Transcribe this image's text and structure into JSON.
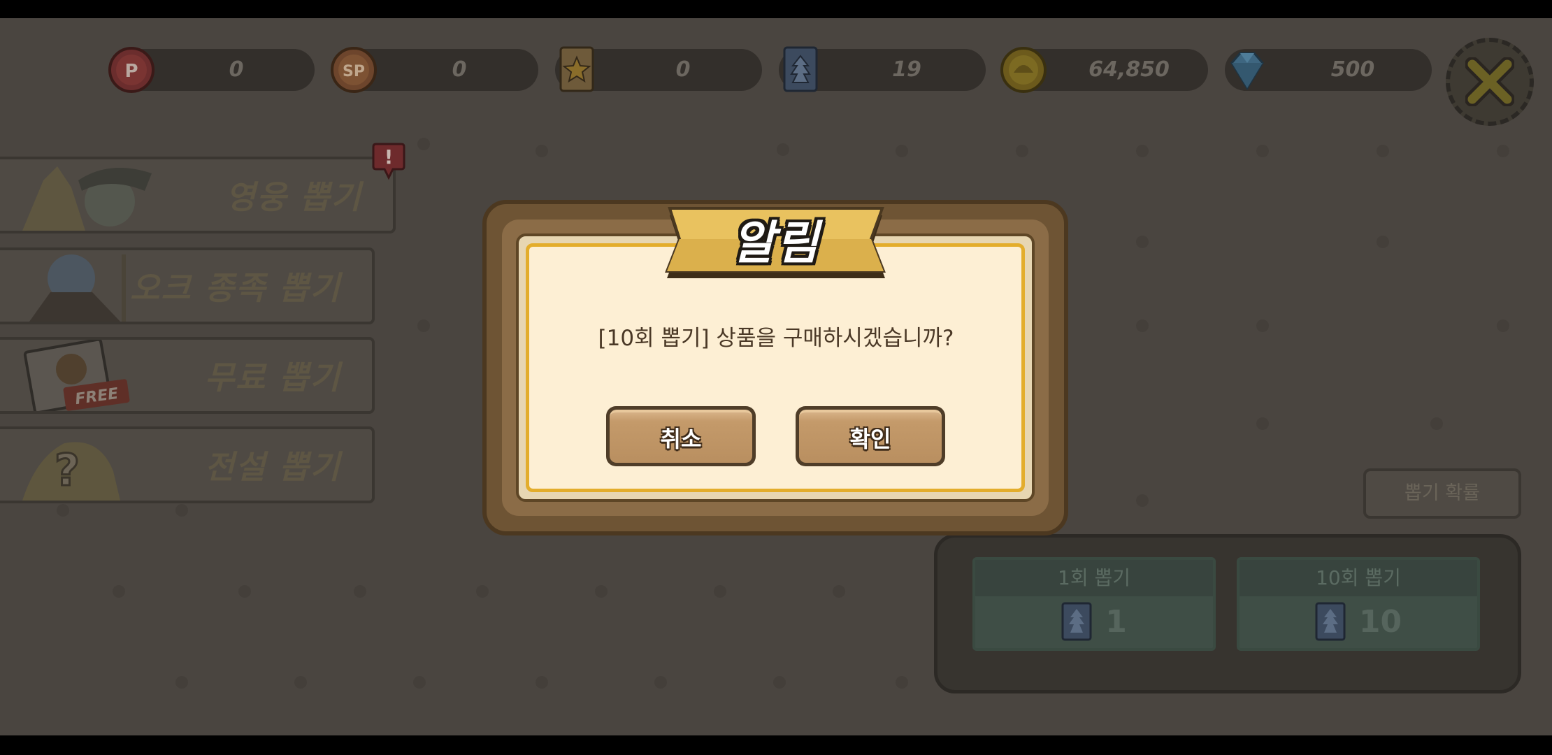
{
  "currencies": [
    {
      "name": "p-point",
      "icon": "p-coin-icon",
      "value": "0"
    },
    {
      "name": "sp-point",
      "icon": "sp-coin-icon",
      "value": "0"
    },
    {
      "name": "star-ticket",
      "icon": "star-ticket-icon",
      "value": "0"
    },
    {
      "name": "draw-ticket",
      "icon": "draw-ticket-icon",
      "value": "19"
    },
    {
      "name": "gold",
      "icon": "gold-coin-icon",
      "value": "64,850"
    },
    {
      "name": "diamond",
      "icon": "diamond-icon",
      "value": "500"
    }
  ],
  "menu": {
    "items": [
      {
        "label": "영웅 뽑기"
      },
      {
        "label": "오크 종족 뽑기"
      },
      {
        "label": "무료 뽑기",
        "tag": "FREE"
      },
      {
        "label": "전설 뽑기"
      }
    ],
    "alert_mark": "!"
  },
  "odds_button": "뽑기 확률",
  "draw_options": [
    {
      "title": "1회 뽑기",
      "cost": "1"
    },
    {
      "title": "10회 뽑기",
      "cost": "10"
    }
  ],
  "dialog": {
    "title": "알림",
    "message": "[10회 뽑기] 상품을 구매하시겠습니까?",
    "cancel_label": "취소",
    "confirm_label": "확인"
  },
  "colors": {
    "dialog_frame": "#6e5434",
    "dialog_panel": "#fdefd4",
    "dialog_border": "#e3ad2c",
    "ribbon": "#e9c25f",
    "button": "#c49a6a",
    "overlay": "#4a4540"
  }
}
